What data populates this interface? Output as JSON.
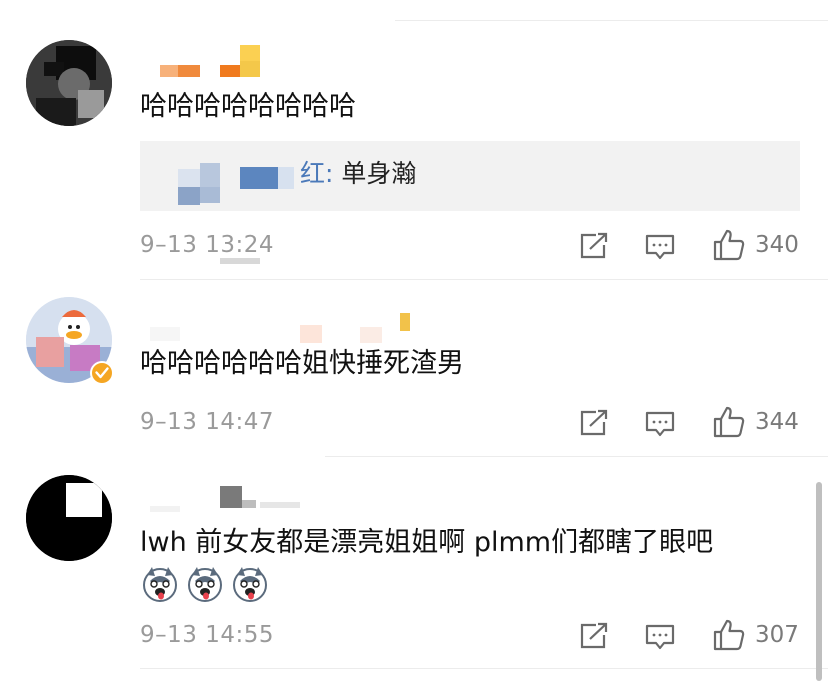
{
  "comments": [
    {
      "text": "哈哈哈哈哈哈哈哈",
      "quote": {
        "author": "红",
        "sep": ": ",
        "body": "单身瀚"
      },
      "time": "9–13 13:24",
      "likes": "340"
    },
    {
      "text": "哈哈哈哈哈哈姐快捶死渣男",
      "time": "9–13 14:47",
      "likes": "344"
    },
    {
      "text": "lwh 前女友都是漂亮姐姐啊 plmm们都瞎了眼吧",
      "time": "9–13 14:55",
      "likes": "307"
    }
  ],
  "icons": {
    "share": "share-icon",
    "comment": "comment-icon",
    "like": "thumbs-up-icon",
    "verified": "verified-badge-icon",
    "emoji": "husky-emoji-icon"
  },
  "colors": {
    "link": "#4b79b9",
    "verified": "#f5a623",
    "meta": "#9a9a9a"
  }
}
